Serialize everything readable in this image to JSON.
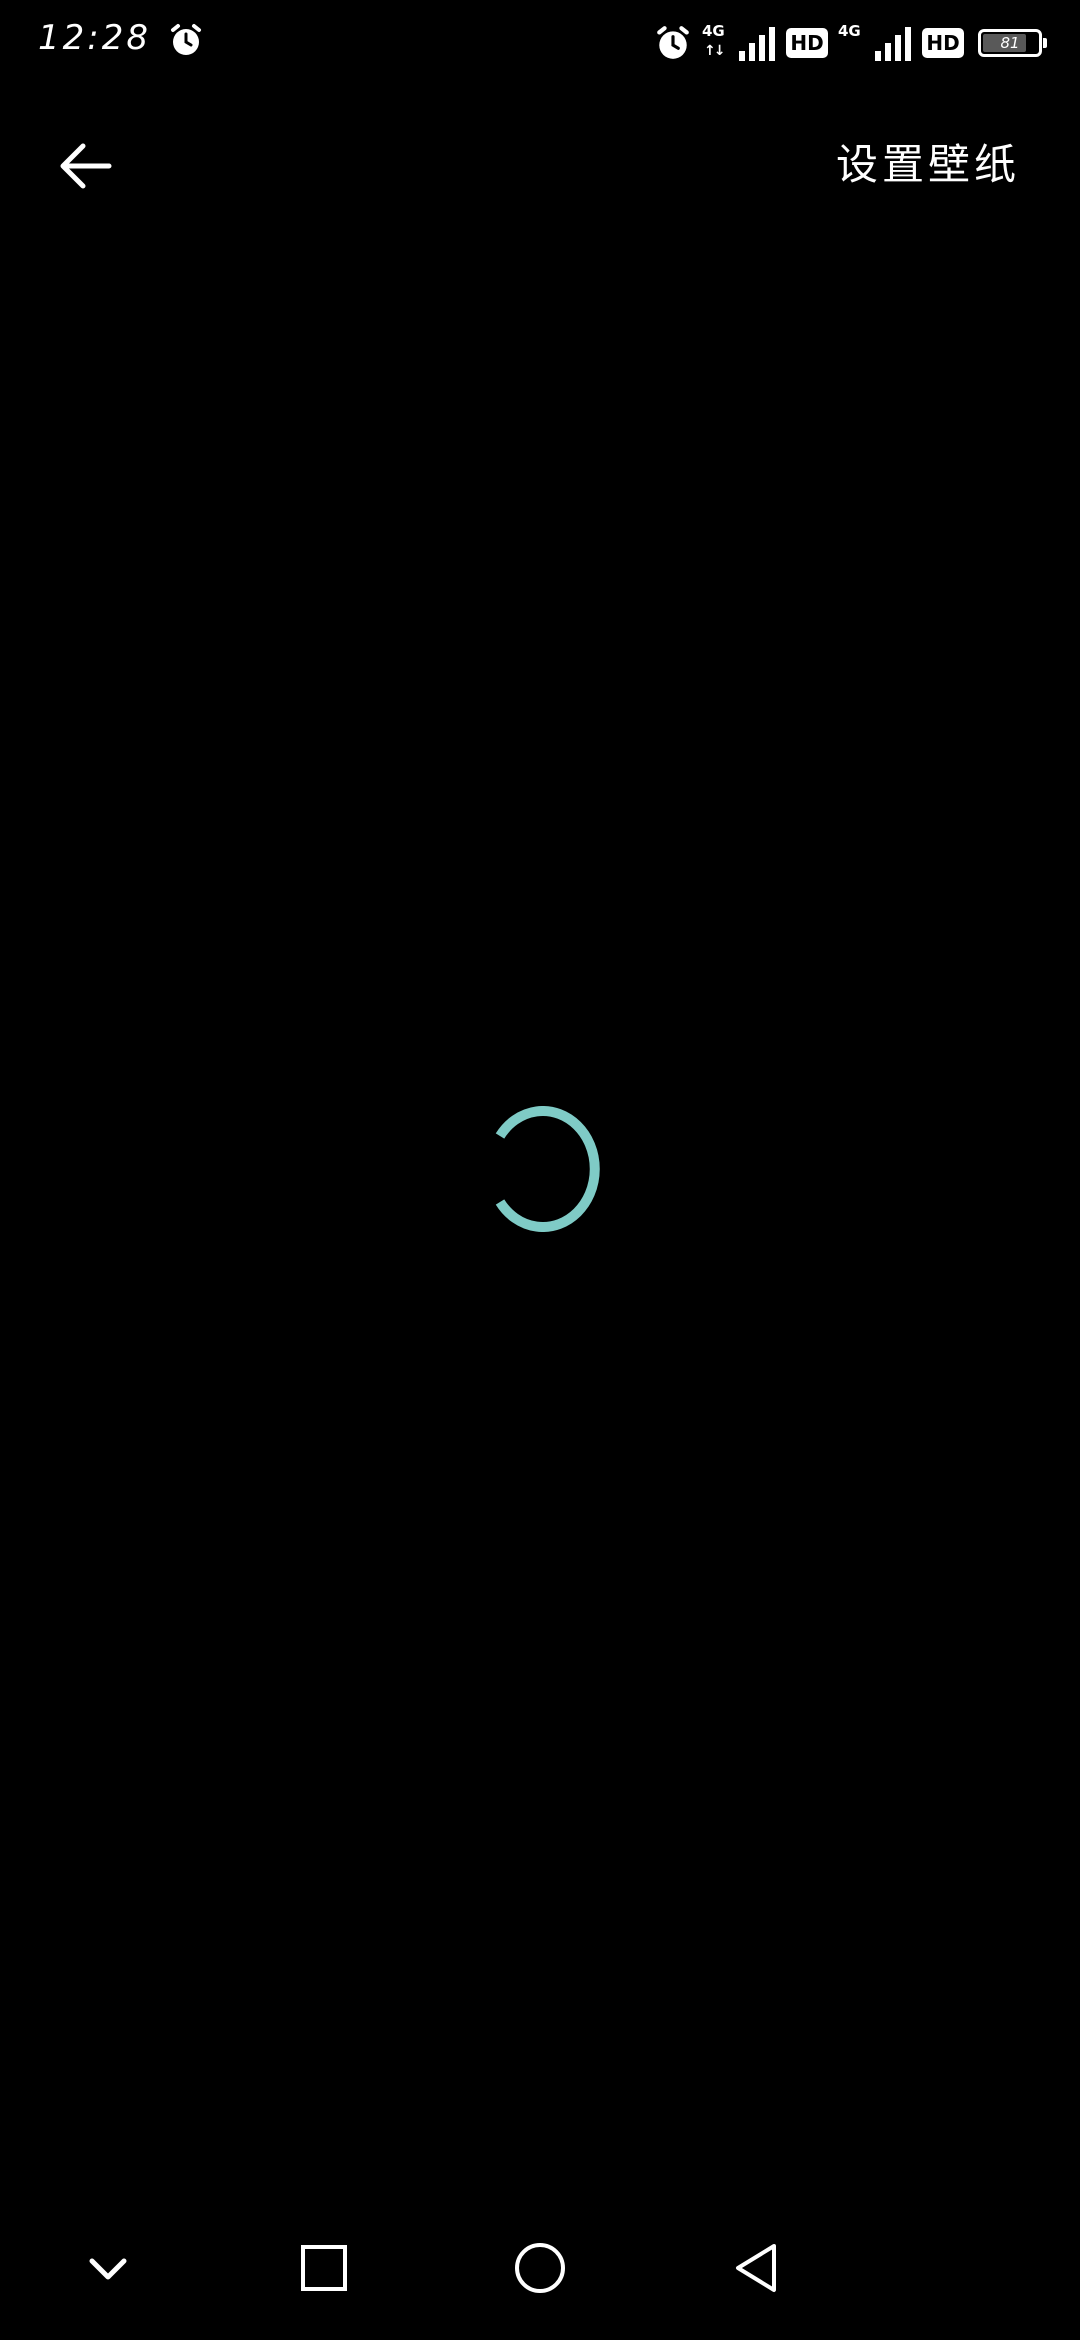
{
  "status_bar": {
    "time": "12:28",
    "battery_level": "81",
    "network_1": "4G",
    "network_2": "4G",
    "hd_label": "HD"
  },
  "toolbar": {
    "set_wallpaper_label": "设置壁纸"
  },
  "colors": {
    "background": "#000000",
    "foreground": "#ffffff",
    "spinner_accent": "#7fcbc6"
  },
  "icons": {
    "back": "back-arrow-icon",
    "spinner": "loading-spinner-icon",
    "nav_down": "chevron-down-icon",
    "nav_recents": "square-icon",
    "nav_home": "circle-icon",
    "nav_back": "triangle-back-icon"
  }
}
